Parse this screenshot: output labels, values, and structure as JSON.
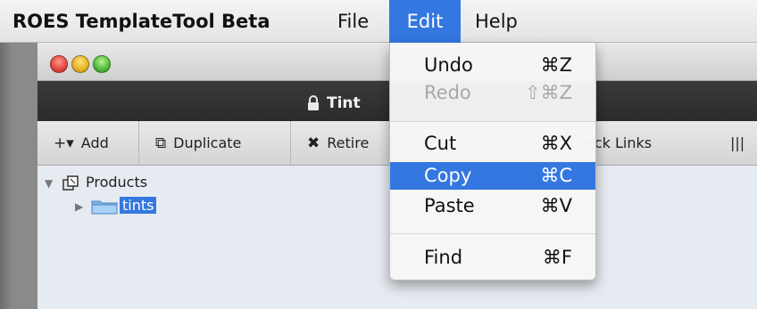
{
  "menubar": {
    "app_name": "ROES TemplateTool Beta",
    "file": "File",
    "edit": "Edit",
    "help": "Help"
  },
  "window": {
    "title": "Tint"
  },
  "toolbar": {
    "add": "Add",
    "add_glyph": "+▾",
    "duplicate": "Duplicate",
    "retire": "Retire",
    "check_links": "eck Links",
    "more": "|||"
  },
  "tree": {
    "root": "Products",
    "child": "tints"
  },
  "edit_menu": {
    "items": [
      {
        "label": "Undo",
        "shortcut": "⌘Z",
        "state": "enabled"
      },
      {
        "label": "Redo",
        "shortcut": "⇧⌘Z",
        "state": "disabled"
      },
      {
        "label": "Cut",
        "shortcut": "⌘X",
        "state": "enabled"
      },
      {
        "label": "Copy",
        "shortcut": "⌘C",
        "state": "highlighted"
      },
      {
        "label": "Paste",
        "shortcut": "⌘V",
        "state": "enabled"
      },
      {
        "label": "Find",
        "shortcut": "⌘F",
        "state": "enabled"
      }
    ]
  },
  "colors": {
    "selection": "#3477e0",
    "menu_bg": "#f6f6f6",
    "disabled_text": "#a8a8a8"
  }
}
